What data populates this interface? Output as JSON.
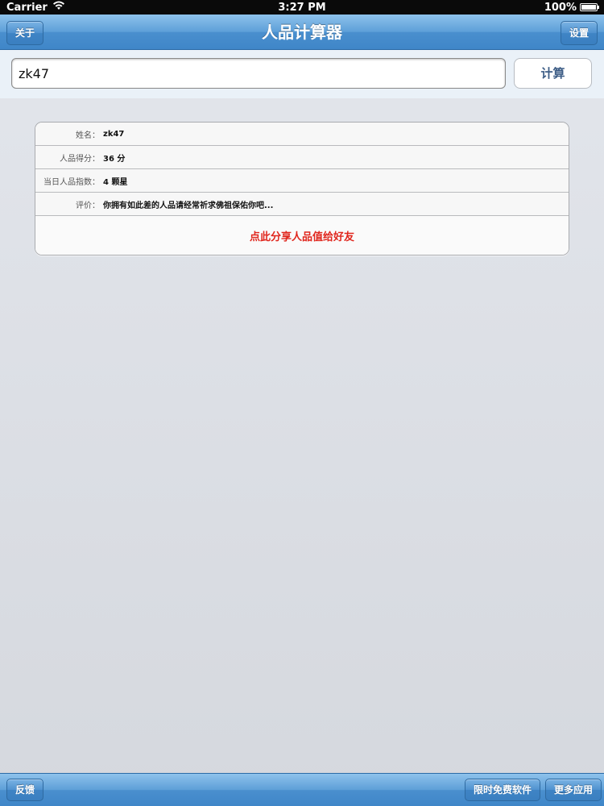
{
  "status_bar": {
    "carrier": "Carrier",
    "time": "3:27 PM",
    "battery": "100%",
    "battery_level": 1.0
  },
  "nav_bar": {
    "title": "人品计算器",
    "left_button": "关于",
    "right_button": "设置"
  },
  "search": {
    "input_value": "zk47",
    "button_label": "计算"
  },
  "results": {
    "rows": [
      {
        "label": "姓名：",
        "value": "zk47"
      },
      {
        "label": "人品得分：",
        "value": "36 分"
      },
      {
        "label": "当日人品指数：",
        "value": "4 颗星"
      },
      {
        "label": "评价：",
        "value": "你拥有如此差的人品请经常祈求佛祖保佑你吧..."
      }
    ],
    "share_label": "点此分享人品值给好友"
  },
  "toolbar": {
    "feedback": "反馈",
    "free_apps": "限时免费软件",
    "more_apps": "更多应用"
  }
}
